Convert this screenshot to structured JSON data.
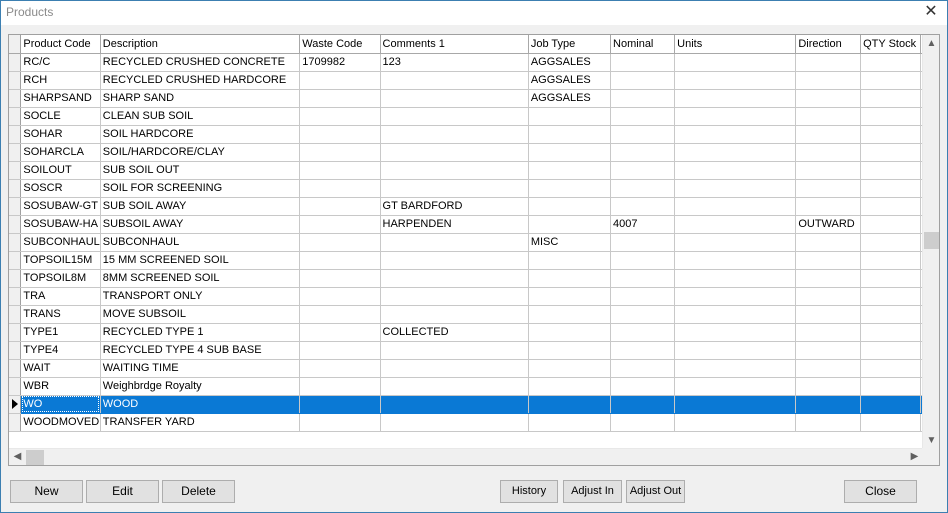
{
  "window": {
    "title": "Products",
    "close_glyph": "✕"
  },
  "grid": {
    "columns": [
      "Product Code",
      "Description",
      "Waste Code",
      "Comments 1",
      "Job Type",
      "Nominal",
      "Units",
      "Direction",
      "QTY Stock"
    ],
    "selected_row": 19,
    "rows": [
      [
        "RC/C",
        "RECYCLED CRUSHED CONCRETE",
        "1709982",
        "123",
        "AGGSALES",
        "",
        "",
        "",
        ""
      ],
      [
        "RCH",
        "RECYCLED CRUSHED HARDCORE",
        "",
        "",
        "AGGSALES",
        "",
        "",
        "",
        ""
      ],
      [
        "SHARPSAND",
        "SHARP SAND",
        "",
        "",
        "AGGSALES",
        "",
        "",
        "",
        ""
      ],
      [
        "SOCLE",
        "CLEAN SUB SOIL",
        "",
        "",
        "",
        "",
        "",
        "",
        ""
      ],
      [
        "SOHAR",
        "SOIL HARDCORE",
        "",
        "",
        "",
        "",
        "",
        "",
        ""
      ],
      [
        "SOHARCLA",
        "SOIL/HARDCORE/CLAY",
        "",
        "",
        "",
        "",
        "",
        "",
        ""
      ],
      [
        "SOILOUT",
        "SUB SOIL OUT",
        "",
        "",
        "",
        "",
        "",
        "",
        ""
      ],
      [
        "SOSCR",
        "SOIL FOR SCREENING",
        "",
        "",
        "",
        "",
        "",
        "",
        ""
      ],
      [
        "SOSUBAW-GT",
        "SUB SOIL AWAY",
        "",
        "GT BARDFORD",
        "",
        "",
        "",
        "",
        ""
      ],
      [
        "SOSUBAW-HA",
        "SUBSOIL AWAY",
        "",
        "HARPENDEN",
        "",
        "4007",
        "",
        "OUTWARD",
        ""
      ],
      [
        "SUBCONHAUL",
        "SUBCONHAUL",
        "",
        "",
        "MISC",
        "",
        "",
        "",
        ""
      ],
      [
        "TOPSOIL15M",
        "15 MM SCREENED SOIL",
        "",
        "",
        "",
        "",
        "",
        "",
        ""
      ],
      [
        "TOPSOIL8M",
        "8MM SCREENED SOIL",
        "",
        "",
        "",
        "",
        "",
        "",
        ""
      ],
      [
        "TRA",
        "TRANSPORT ONLY",
        "",
        "",
        "",
        "",
        "",
        "",
        ""
      ],
      [
        "TRANS",
        "MOVE SUBSOIL",
        "",
        "",
        "",
        "",
        "",
        "",
        ""
      ],
      [
        "TYPE1",
        "RECYCLED TYPE 1",
        "",
        "COLLECTED",
        "",
        "",
        "",
        "",
        ""
      ],
      [
        "TYPE4",
        "RECYCLED TYPE 4 SUB BASE",
        "",
        "",
        "",
        "",
        "",
        "",
        ""
      ],
      [
        "WAIT",
        "WAITING TIME",
        "",
        "",
        "",
        "",
        "",
        "",
        ""
      ],
      [
        "WBR",
        "Weighbrdge Royalty",
        "",
        "",
        "",
        "",
        "",
        "",
        ""
      ],
      [
        "WO",
        "WOOD",
        "",
        "",
        "",
        "",
        "",
        "",
        ""
      ],
      [
        "WOODMOVED",
        "TRANSFER YARD",
        "",
        "",
        "",
        "",
        "",
        "",
        ""
      ]
    ]
  },
  "scrollbars": {
    "up": "▲",
    "down": "▼",
    "left": "◀",
    "right": "▶"
  },
  "buttons": {
    "new": "New",
    "edit": "Edit",
    "delete": "Delete",
    "history": "History",
    "adjust_in": "Adjust In",
    "adjust_out": "Adjust Out",
    "close": "Close"
  }
}
